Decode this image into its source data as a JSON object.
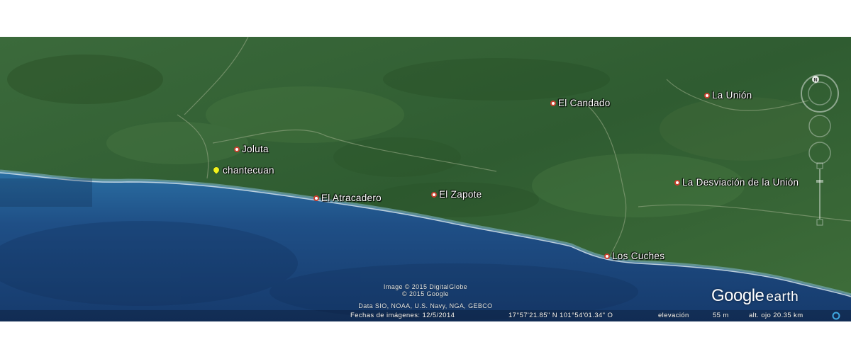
{
  "places": [
    {
      "name": "Joluta"
    },
    {
      "name": "chantecuan"
    },
    {
      "name": "El Atracadero"
    },
    {
      "name": "El Zapote"
    },
    {
      "name": "El Candado"
    },
    {
      "name": "La Unión"
    },
    {
      "name": "La Desviación de la Unión"
    },
    {
      "name": "Los Cuches"
    }
  ],
  "credits": {
    "line1": "Image © 2015 DigitalGlobe",
    "line2": "© 2015 Google",
    "line3": "Data SIO, NOAA, U.S. Navy, NGA, GEBCO"
  },
  "status": {
    "date": "Fechas de imágenes: 12/5/2014",
    "coords": "17°57'21.85\" N  101°54'01.34\" O",
    "elevation_label": "elevación",
    "elevation_value": "55 m",
    "eye_alt": "alt. ojo  20.35 km"
  },
  "logo": {
    "google": "Google",
    "earth": "earth"
  },
  "compass": {
    "north": "N"
  },
  "colors": {
    "land": "#355c36",
    "ocean": "#1f4f86",
    "shallow": "#2f73a6",
    "pin": "#c8402e",
    "pushpin": "#f2f21c"
  }
}
